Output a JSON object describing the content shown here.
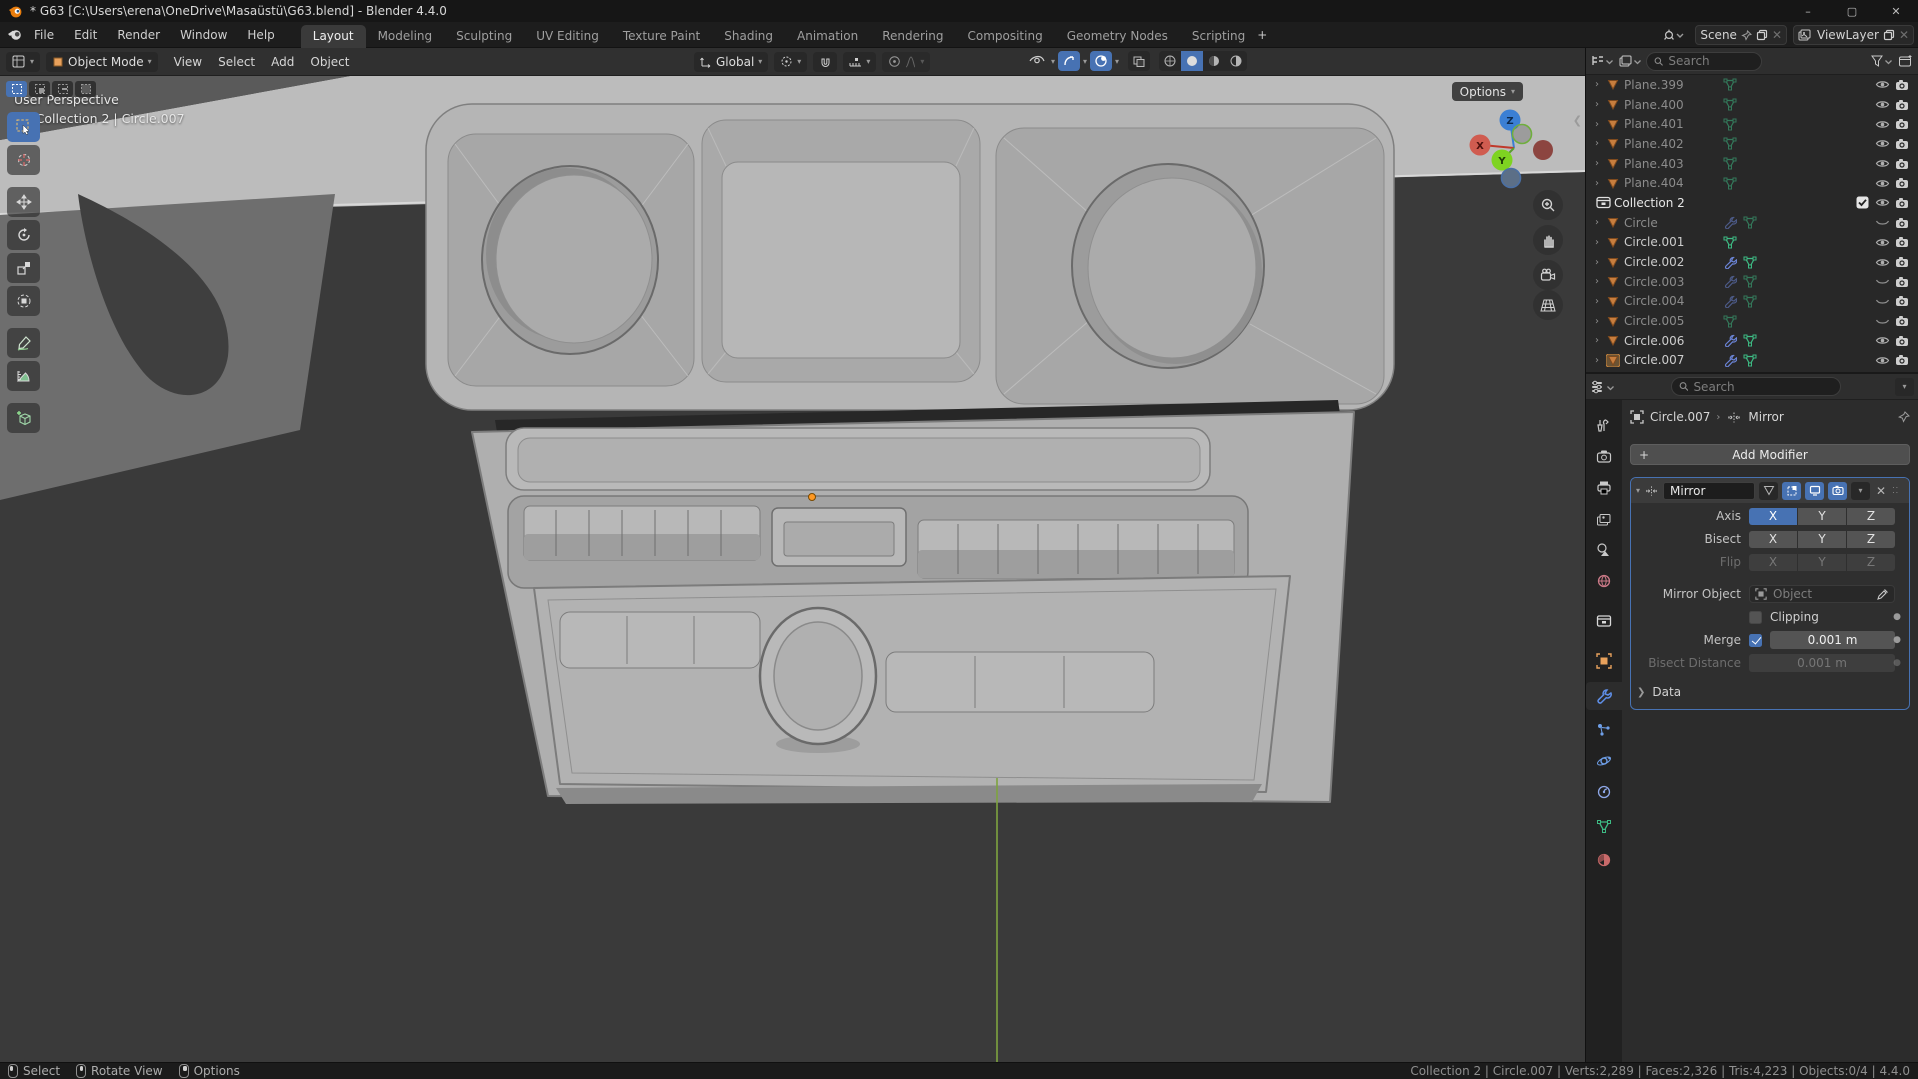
{
  "window": {
    "title": "* G63 [C:\\Users\\erena\\OneDrive\\Masaüstü\\G63.blend] - Blender 4.4.0",
    "controls": {
      "minimize": "–",
      "maximize": "▢",
      "close": "✕"
    }
  },
  "topbar": {
    "menus": [
      "File",
      "Edit",
      "Render",
      "Window",
      "Help"
    ],
    "workspaces": [
      {
        "label": "Layout",
        "active": true
      },
      {
        "label": "Modeling"
      },
      {
        "label": "Sculpting"
      },
      {
        "label": "UV Editing"
      },
      {
        "label": "Texture Paint"
      },
      {
        "label": "Shading"
      },
      {
        "label": "Animation"
      },
      {
        "label": "Rendering"
      },
      {
        "label": "Compositing"
      },
      {
        "label": "Geometry Nodes"
      },
      {
        "label": "Scripting"
      }
    ],
    "add_workspace": "+",
    "scene": "Scene",
    "view_layer": "ViewLayer"
  },
  "viewport_header": {
    "mode": "Object Mode",
    "menus": [
      "View",
      "Select",
      "Add",
      "Object"
    ],
    "orientation": "Global",
    "options_label": "Options"
  },
  "viewport": {
    "overlay_line1": "User Perspective",
    "overlay_line2": "(2) Collection 2 | Circle.007",
    "gizmo": {
      "x": "X",
      "y": "Y",
      "z": "Z"
    },
    "tools": [
      "select-box",
      "cursor",
      "move",
      "rotate",
      "scale",
      "transform",
      "annotate",
      "measure",
      "add-cube"
    ],
    "active_tool": "select-box"
  },
  "outliner": {
    "search_placeholder": "Search",
    "items": [
      {
        "label": "Plane.399",
        "chevron": true,
        "mesh": true,
        "data_icon": true,
        "eye_open": true,
        "dim": true
      },
      {
        "label": "Plane.400",
        "chevron": true,
        "mesh": true,
        "data_icon": true,
        "eye_open": true,
        "dim": true
      },
      {
        "label": "Plane.401",
        "chevron": true,
        "mesh": true,
        "data_icon": true,
        "eye_open": true,
        "dim": true
      },
      {
        "label": "Plane.402",
        "chevron": true,
        "mesh": true,
        "data_icon": true,
        "eye_open": true,
        "dim": true
      },
      {
        "label": "Plane.403",
        "chevron": true,
        "mesh": true,
        "data_icon": true,
        "eye_open": true,
        "dim": true
      },
      {
        "label": "Plane.404",
        "chevron": true,
        "mesh": true,
        "data_icon": true,
        "eye_open": true,
        "dim": true
      },
      {
        "label": "Collection 2",
        "collection": true,
        "checkbox": true,
        "eye_open": true
      },
      {
        "label": "Circle",
        "chevron": true,
        "mesh": true,
        "wrench": true,
        "data_icon": true,
        "eye_closed": true,
        "dim": true
      },
      {
        "label": "Circle.001",
        "chevron": true,
        "mesh": true,
        "data_icon": true,
        "eye_open": true
      },
      {
        "label": "Circle.002",
        "chevron": true,
        "mesh": true,
        "wrench": true,
        "data_icon": true,
        "eye_open": true
      },
      {
        "label": "Circle.003",
        "chevron": true,
        "mesh": true,
        "wrench": true,
        "data_icon": true,
        "eye_closed": true,
        "dim": true
      },
      {
        "label": "Circle.004",
        "chevron": true,
        "mesh": true,
        "wrench": true,
        "data_icon": true,
        "eye_closed": true,
        "dim": true
      },
      {
        "label": "Circle.005",
        "chevron": true,
        "mesh": true,
        "data_icon": true,
        "eye_closed": true,
        "dim": true
      },
      {
        "label": "Circle.006",
        "chevron": true,
        "mesh": true,
        "wrench": true,
        "data_icon": true,
        "eye_open": true
      },
      {
        "label": "Circle.007",
        "chevron": true,
        "mesh": true,
        "wrench": true,
        "data_icon": true,
        "eye_open": true,
        "active": true
      }
    ]
  },
  "properties": {
    "search_placeholder": "Search",
    "breadcrumb": {
      "object": "Circle.007",
      "separator": "›",
      "modifier": "Mirror"
    },
    "add_modifier_label": "Add Modifier",
    "tabs": [
      "tool",
      "render",
      "output",
      "view-layer",
      "scene",
      "world",
      "collection",
      "object",
      "modifiers",
      "particles",
      "physics",
      "constraints",
      "data",
      "material"
    ],
    "active_tab": "modifiers",
    "modifier": {
      "name": "Mirror",
      "axis": {
        "label": "Axis",
        "options": [
          "X",
          "Y",
          "Z"
        ],
        "active": [
          "X"
        ]
      },
      "bisect": {
        "label": "Bisect",
        "options": [
          "X",
          "Y",
          "Z"
        ],
        "active": []
      },
      "flip": {
        "label": "Flip",
        "options": [
          "X",
          "Y",
          "Z"
        ],
        "disabled": true
      },
      "mirror_object": {
        "label": "Mirror Object",
        "placeholder": "Object"
      },
      "clipping": {
        "label": "Clipping",
        "checked": false
      },
      "merge": {
        "label": "Merge",
        "checked": true,
        "value": "0.001 m"
      },
      "bisect_distance": {
        "label": "Bisect Distance",
        "value": "0.001 m",
        "disabled": true
      },
      "data_section": "Data"
    }
  },
  "statusbar": {
    "hints": [
      {
        "icon": "lmb",
        "label": "Select"
      },
      {
        "icon": "mmb",
        "label": "Rotate View"
      },
      {
        "icon": "rmb",
        "label": "Options"
      }
    ],
    "right": "Collection 2 | Circle.007 | Verts:2,289 | Faces:2,326 | Tris:4,223 | Objects:0/4 | 4.4.0"
  },
  "colors": {
    "accent": "#4772b3",
    "axis_x": "#e0564e",
    "axis_y": "#71c02f",
    "axis_z": "#3b7fd4",
    "origin_dot": "#ff9822",
    "y_axis_line": "#7ea33f"
  }
}
